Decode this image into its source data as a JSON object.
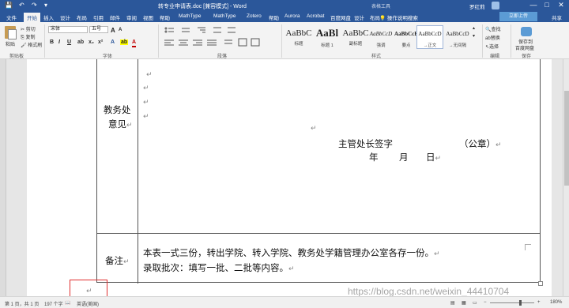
{
  "window": {
    "title": "转专业申请表.doc [兼容模式] - Word",
    "context": "表格工具",
    "user": "罗红莉",
    "controls": {
      "minimize": "—",
      "maximize": "□",
      "close": "✕"
    }
  },
  "quick_access": {
    "save": "💾",
    "undo": "↶",
    "redo": "↷",
    "more": "▾"
  },
  "tabs": [
    "文件",
    "开始",
    "插入",
    "设计",
    "布局",
    "引用",
    "邮件",
    "审阅",
    "视图",
    "帮助",
    "MathType",
    "MathType",
    "Zotero",
    "帮助",
    "Aurora",
    "Acrobat",
    "百度网盘",
    "设计",
    "布局"
  ],
  "active_tab": "开始",
  "tell_me": "操作说明搜索",
  "share": "共享",
  "sync_button": "立即上传",
  "ribbon": {
    "clipboard": {
      "paste": "粘贴",
      "cut": "剪切",
      "copy": "复制",
      "format_painter": "格式刷",
      "label": "剪贴板"
    },
    "font": {
      "name": "宋体",
      "size": "五号",
      "label": "字体",
      "bold": "B",
      "italic": "I",
      "underline": "U",
      "grow": "A",
      "shrink": "A"
    },
    "paragraph": {
      "label": "段落"
    },
    "styles": {
      "label": "样式",
      "items": [
        {
          "sample": "AaBbC",
          "name": "标题"
        },
        {
          "sample": "AaBl",
          "name": "标题 1"
        },
        {
          "sample": "AaBbC",
          "name": "副标题"
        },
        {
          "sample": "AaBbCcD",
          "name": "强调"
        },
        {
          "sample": "AaBbCcE",
          "name": "要点"
        },
        {
          "sample": "AaBbCcD",
          "name": "→正文"
        },
        {
          "sample": "AaBbCcD",
          "name": "→无间隔"
        }
      ]
    },
    "editing": {
      "find": "查找",
      "replace": "替换",
      "select": "选择",
      "label": "编辑"
    },
    "save_cloud": {
      "line1": "保存到",
      "line2": "百度网盘",
      "label": "保存"
    }
  },
  "document": {
    "jiaowu_line1": "教务处",
    "jiaowu_line2": "意见",
    "signature": "主管处长签字",
    "seal": "（公章）",
    "year": "年",
    "month": "月",
    "day": "日",
    "remark_label": "备注",
    "remark_line1": "本表一式三份，转出学院、转入学院、教务处学籍管理办公室各存一份。",
    "remark_line2": "录取批次：填写一批、二批等内容。",
    "para_mark": "↵"
  },
  "status": {
    "page": "第 1 页，共 1 页",
    "words": "197 个字",
    "lang": "英语(美国)",
    "zoom": "180%"
  },
  "watermark": "https://blog.csdn.net/weixin_44410704"
}
